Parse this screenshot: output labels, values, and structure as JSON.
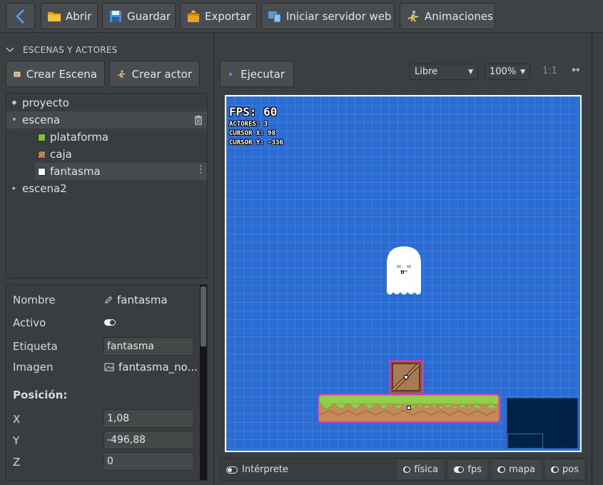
{
  "toolbar": {
    "buttons": [
      {
        "label": "Abrir"
      },
      {
        "label": "Guardar"
      },
      {
        "label": "Exportar"
      },
      {
        "label": "Iniciar servidor web"
      },
      {
        "label": "Animaciones"
      }
    ]
  },
  "left_panel": {
    "section_title": "ESCENAS Y ACTORES",
    "create_scene_label": "Crear Escena",
    "create_actor_label": "Crear actor",
    "tree": [
      {
        "label": "proyecto",
        "marker": "◆"
      },
      {
        "label": "escena",
        "marker": "▾"
      },
      {
        "label": "plataforma",
        "color": "#7fbf3a"
      },
      {
        "label": "caja",
        "color": "#b07a4a"
      },
      {
        "label": "fantasma",
        "color": "#ffffff"
      },
      {
        "label": "escena2",
        "marker": "▸"
      }
    ]
  },
  "properties": {
    "name_label": "Nombre",
    "name_value": "fantasma",
    "active_label": "Activo",
    "tag_label": "Etiqueta",
    "tag_value": "fantasma",
    "image_label": "Imagen",
    "image_value": "fantasma_no...",
    "position_heading": "Posición:",
    "x_label": "X",
    "x_value": "1,08",
    "y_label": "Y",
    "y_value": "-496,88",
    "z_label": "Z",
    "z_value": "0"
  },
  "canvas_toolbar": {
    "run_label": "Ejecutar",
    "mode_select": "Libre",
    "zoom_select": "100%",
    "ratio_label": "1:1",
    "expand_icon": "↔"
  },
  "stage": {
    "fps": "FPS: 60",
    "actors": "ACTORES: 3",
    "cursor_x": "CURSOR X: 98",
    "cursor_y": "CURSOR Y: -336",
    "background_color": "#2a6cd2"
  },
  "statusbar": {
    "interpreter_label": "Intérprete",
    "toggles": [
      {
        "label": "física"
      },
      {
        "label": "fps"
      },
      {
        "label": "mapa"
      },
      {
        "label": "pos"
      }
    ]
  }
}
